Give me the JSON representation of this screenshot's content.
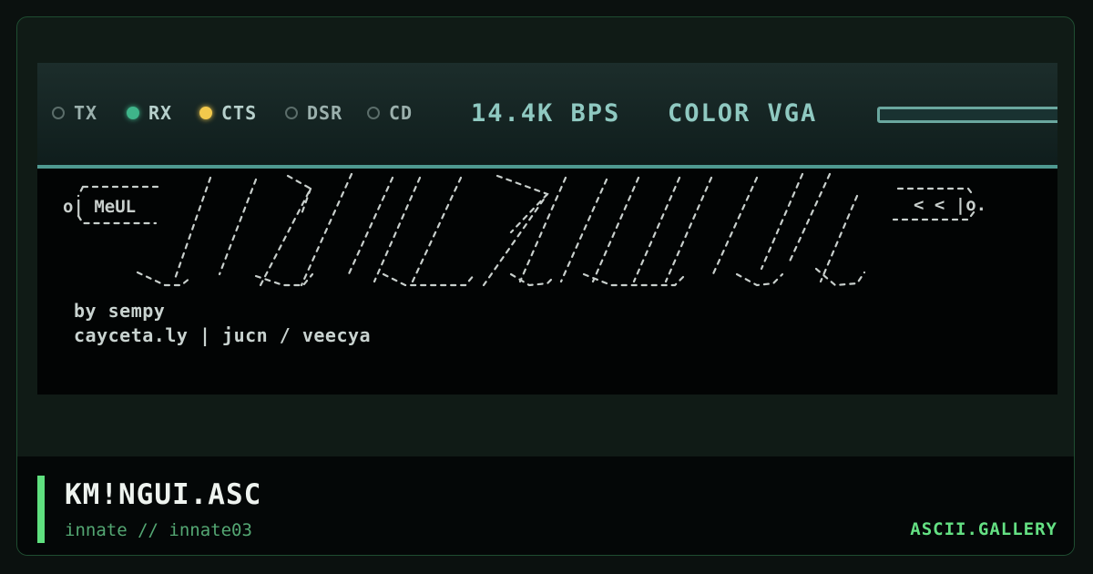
{
  "artwork": {
    "title": "KM!NGUI.ASC",
    "byline": "innate // innate03",
    "site": "ASCII.GALLERY"
  },
  "status_bar": {
    "indicators": [
      {
        "label": "TX",
        "state": "off"
      },
      {
        "label": "RX",
        "state": "on",
        "color": "#3fb58a"
      },
      {
        "label": "CTS",
        "state": "on",
        "color": "#f2c94c"
      },
      {
        "label": "DSR",
        "state": "off"
      },
      {
        "label": "CD",
        "state": "off"
      }
    ],
    "baud_rate": "14.4K BPS",
    "display_mode": "COLOR VGA"
  },
  "ascii_art": {
    "left_tag": "o| MeUL",
    "right_tag": "< < |o.",
    "credit_lines": [
      "by sempy",
      "cayceta.ly | jucn / veecya"
    ]
  },
  "colors": {
    "accent": "#5fe07f",
    "screen_glow": "#4f9a91"
  }
}
